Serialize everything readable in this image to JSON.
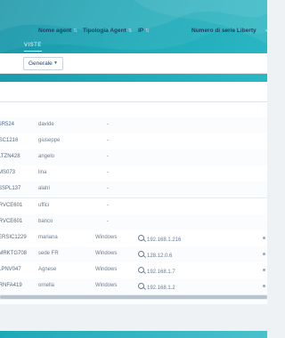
{
  "views": {
    "label": "VISTE",
    "selected": "Generale",
    "left_value": ""
  },
  "table": {
    "columns": [
      "Nome agent",
      "Tipologia Agent",
      "IP",
      "Numero di serie Liberty"
    ],
    "rows": [
      {
        "id": "TSR524",
        "name": "davide",
        "type": "-",
        "ip": ""
      },
      {
        "id": "GSC1216",
        "name": "giuseppe",
        "type": "-",
        "ip": ""
      },
      {
        "id": "SLTZN428",
        "name": "angelo",
        "type": "-",
        "ip": ""
      },
      {
        "id": "EMS073",
        "name": "lina",
        "type": "-",
        "ip": ""
      },
      {
        "id": "ASSPL137",
        "name": "alatri",
        "type": "-",
        "ip": ""
      },
      {
        "id": "GRVCE601",
        "name": "uffici",
        "type": "-",
        "ip": ""
      },
      {
        "id": "GRVCE601",
        "name": "banco",
        "type": "-",
        "ip": ""
      },
      {
        "id": "PERSIC1229",
        "name": "mariana",
        "type": "Windows",
        "ip": "192.168.1.216"
      },
      {
        "id": "DMRKTG708",
        "name": "sede FR",
        "type": "Windows",
        "ip": "128.12.0.6"
      },
      {
        "id": "SLPNV047",
        "name": "Agnese",
        "type": "Windows",
        "ip": "192.168.1.7"
      },
      {
        "id": "ORNFA419",
        "name": "ornella",
        "type": "Windows",
        "ip": "192.168.1.2"
      }
    ]
  }
}
